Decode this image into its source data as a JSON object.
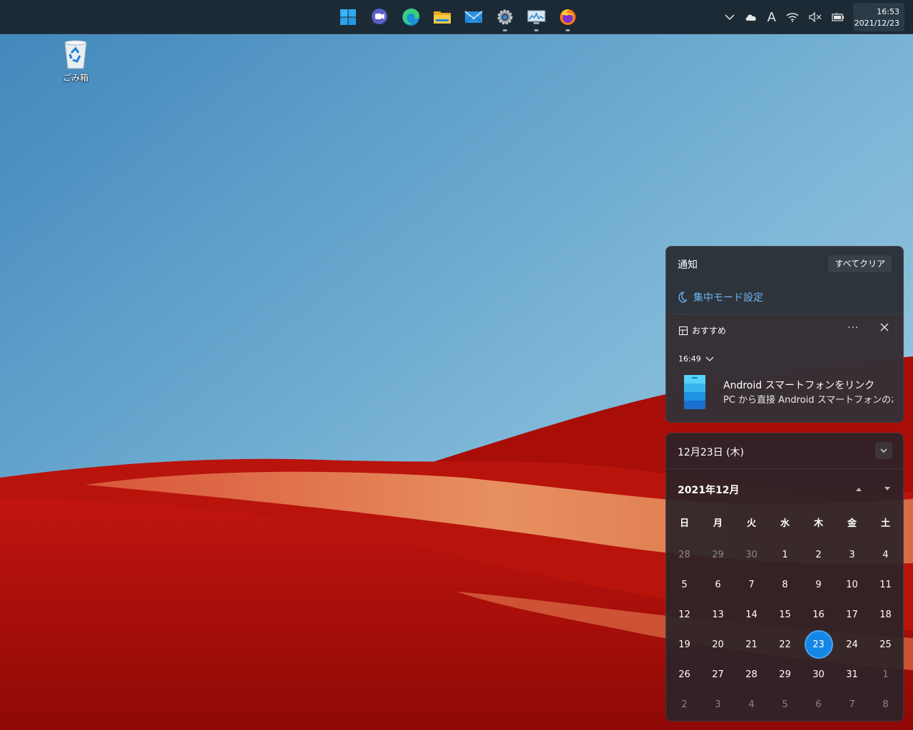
{
  "desktop": {
    "recycle_bin_label": "ごみ箱"
  },
  "taskbar": {
    "apps": [
      {
        "name": "start",
        "icon": "windows-start-icon",
        "running": false
      },
      {
        "name": "chat",
        "icon": "teams-chat-icon",
        "running": false
      },
      {
        "name": "edge",
        "icon": "edge-icon",
        "running": false
      },
      {
        "name": "explorer",
        "icon": "folder-icon",
        "running": false
      },
      {
        "name": "mail",
        "icon": "mail-icon",
        "running": false
      },
      {
        "name": "settings",
        "icon": "gear-icon",
        "running": true
      },
      {
        "name": "monitor",
        "icon": "performance-monitor-icon",
        "running": true
      },
      {
        "name": "firefox",
        "icon": "firefox-icon",
        "running": true
      }
    ],
    "tray": {
      "ime_label": "A"
    },
    "clock": {
      "time": "16:53",
      "date": "2021/12/23"
    }
  },
  "notifications": {
    "title": "通知",
    "clear_all": "すべてクリア",
    "focus_assist": "集中モード設定",
    "card": {
      "app_name": "おすすめ",
      "more": "···",
      "time": "16:49",
      "title": "Android スマートフォンをリンク",
      "body": "PC から直接 Android スマートフォンのお気に"
    }
  },
  "calendar": {
    "header_date": "12月23日 (木)",
    "month_label": "2021年12月",
    "weekdays": [
      "日",
      "月",
      "火",
      "水",
      "木",
      "金",
      "土"
    ],
    "days": [
      {
        "n": "28",
        "dim": true
      },
      {
        "n": "29",
        "dim": true
      },
      {
        "n": "30",
        "dim": true
      },
      {
        "n": "1"
      },
      {
        "n": "2"
      },
      {
        "n": "3"
      },
      {
        "n": "4"
      },
      {
        "n": "5"
      },
      {
        "n": "6"
      },
      {
        "n": "7"
      },
      {
        "n": "8"
      },
      {
        "n": "9"
      },
      {
        "n": "10"
      },
      {
        "n": "11"
      },
      {
        "n": "12"
      },
      {
        "n": "13"
      },
      {
        "n": "14"
      },
      {
        "n": "15"
      },
      {
        "n": "16"
      },
      {
        "n": "17"
      },
      {
        "n": "18"
      },
      {
        "n": "19"
      },
      {
        "n": "20"
      },
      {
        "n": "21"
      },
      {
        "n": "22"
      },
      {
        "n": "23",
        "today": true
      },
      {
        "n": "24"
      },
      {
        "n": "25"
      },
      {
        "n": "26"
      },
      {
        "n": "27"
      },
      {
        "n": "28"
      },
      {
        "n": "29"
      },
      {
        "n": "30"
      },
      {
        "n": "31"
      },
      {
        "n": "1",
        "dim": true
      },
      {
        "n": "2",
        "dim": true
      },
      {
        "n": "3",
        "dim": true
      },
      {
        "n": "4",
        "dim": true
      },
      {
        "n": "5",
        "dim": true
      },
      {
        "n": "6",
        "dim": true
      },
      {
        "n": "7",
        "dim": true
      },
      {
        "n": "8",
        "dim": true
      }
    ]
  },
  "colors": {
    "accent": "#1586e6",
    "link": "#6fb4ef",
    "taskbar": "#1c2a36"
  }
}
